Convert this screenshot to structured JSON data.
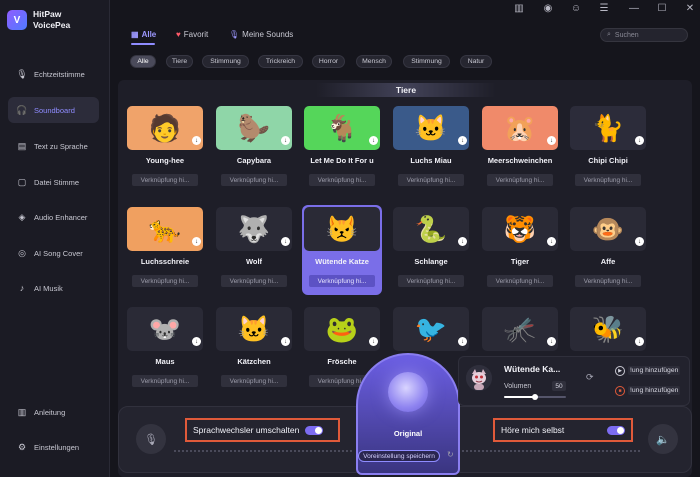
{
  "app": {
    "title_line1": "HitPaw",
    "title_line2": "VoicePea",
    "logo_glyph": "V"
  },
  "sidebar": {
    "items": [
      {
        "label": "Echtzeitstimme",
        "icon": "microphone-icon",
        "active": false
      },
      {
        "label": "Soundboard",
        "icon": "headphones-icon",
        "active": true
      },
      {
        "label": "Text zu Sprache",
        "icon": "text-icon",
        "active": false
      },
      {
        "label": "Datei Stimme",
        "icon": "file-icon",
        "active": false
      },
      {
        "label": "Audio Enhancer",
        "icon": "enhancer-icon",
        "active": false
      },
      {
        "label": "AI Song Cover",
        "icon": "music-disc-icon",
        "active": false
      },
      {
        "label": "AI Musik",
        "icon": "music-note-icon",
        "active": false
      }
    ],
    "bottom": [
      {
        "label": "Anleitung",
        "icon": "book-icon"
      },
      {
        "label": "Einstellungen",
        "icon": "gear-icon"
      }
    ]
  },
  "topbar": {
    "icons": [
      "book-icon",
      "discord-icon",
      "user-icon",
      "menu-icon",
      "minimize-icon",
      "maximize-icon",
      "close-icon"
    ]
  },
  "tabs": [
    {
      "label": "Alle",
      "icon": "grid-icon",
      "active": true
    },
    {
      "label": "Favorit",
      "icon": "heart-icon",
      "active": false
    },
    {
      "label": "Meine Sounds",
      "icon": "mic-icon",
      "active": false
    }
  ],
  "search": {
    "placeholder": "Suchen"
  },
  "filters": [
    "Alle",
    "Tiere",
    "Stimmung",
    "Trickreich",
    "Horror",
    "Mensch",
    "Stimmung",
    "Natur"
  ],
  "section": {
    "title": "Tiere"
  },
  "shortcut_label": "Verknüpfung hi...",
  "cards": [
    {
      "name": "Young-hee",
      "emoji": "🧑",
      "bg": "#f0a36a"
    },
    {
      "name": "Capybara",
      "emoji": "🦫",
      "bg": "#8fd6a8"
    },
    {
      "name": "Let Me Do It For u",
      "emoji": "🐐",
      "bg": "#55d65a"
    },
    {
      "name": "Luchs Miau",
      "emoji": "🐱",
      "bg": "#3a5a8a"
    },
    {
      "name": "Meerschweinchen",
      "emoji": "🐹",
      "bg": "#f08a6a"
    },
    {
      "name": "Chipi Chipi",
      "emoji": "🐈",
      "bg": "#2c2c3a"
    },
    {
      "name": "Luchsschreie",
      "emoji": "🐆",
      "bg": "#f0a060"
    },
    {
      "name": "Wolf",
      "emoji": "🐺",
      "bg": "#2a2a36"
    },
    {
      "name": "Wütende Katze",
      "emoji": "😾",
      "bg": "#2a2a36",
      "selected": true
    },
    {
      "name": "Schlange",
      "emoji": "🐍",
      "bg": "#2a2a36"
    },
    {
      "name": "Tiger",
      "emoji": "🐯",
      "bg": "#2a2a36"
    },
    {
      "name": "Affe",
      "emoji": "🐵",
      "bg": "#2a2a36"
    },
    {
      "name": "Maus",
      "emoji": "🐭",
      "bg": "#2a2a36"
    },
    {
      "name": "Kätzchen",
      "emoji": "🐱",
      "bg": "#2a2a36"
    },
    {
      "name": "Frösche",
      "emoji": "🐸",
      "bg": "#2a2a36"
    },
    {
      "name": "",
      "emoji": "🐦",
      "bg": "#2a2a36"
    },
    {
      "name": "",
      "emoji": "🦟",
      "bg": "#2a2a36"
    },
    {
      "name": "",
      "emoji": "🐝",
      "bg": "#2a2a36"
    }
  ],
  "bottom": {
    "switch_label": "Sprachwechsler umschalten",
    "hear_self_label": "Höre mich selbst",
    "original_label": "Original",
    "preset_label": "Voreinstellung speichern",
    "voice_title": "Wütende Ka...",
    "volume_label": "Volumen",
    "volume_value": "50",
    "volume_level": 0.5,
    "hotkey1": "!ung hinzufügen",
    "hotkey2": "!ung hinzufügen"
  },
  "colors": {
    "accent": "#8f8cff",
    "highlight_box": "#e05a3a"
  }
}
